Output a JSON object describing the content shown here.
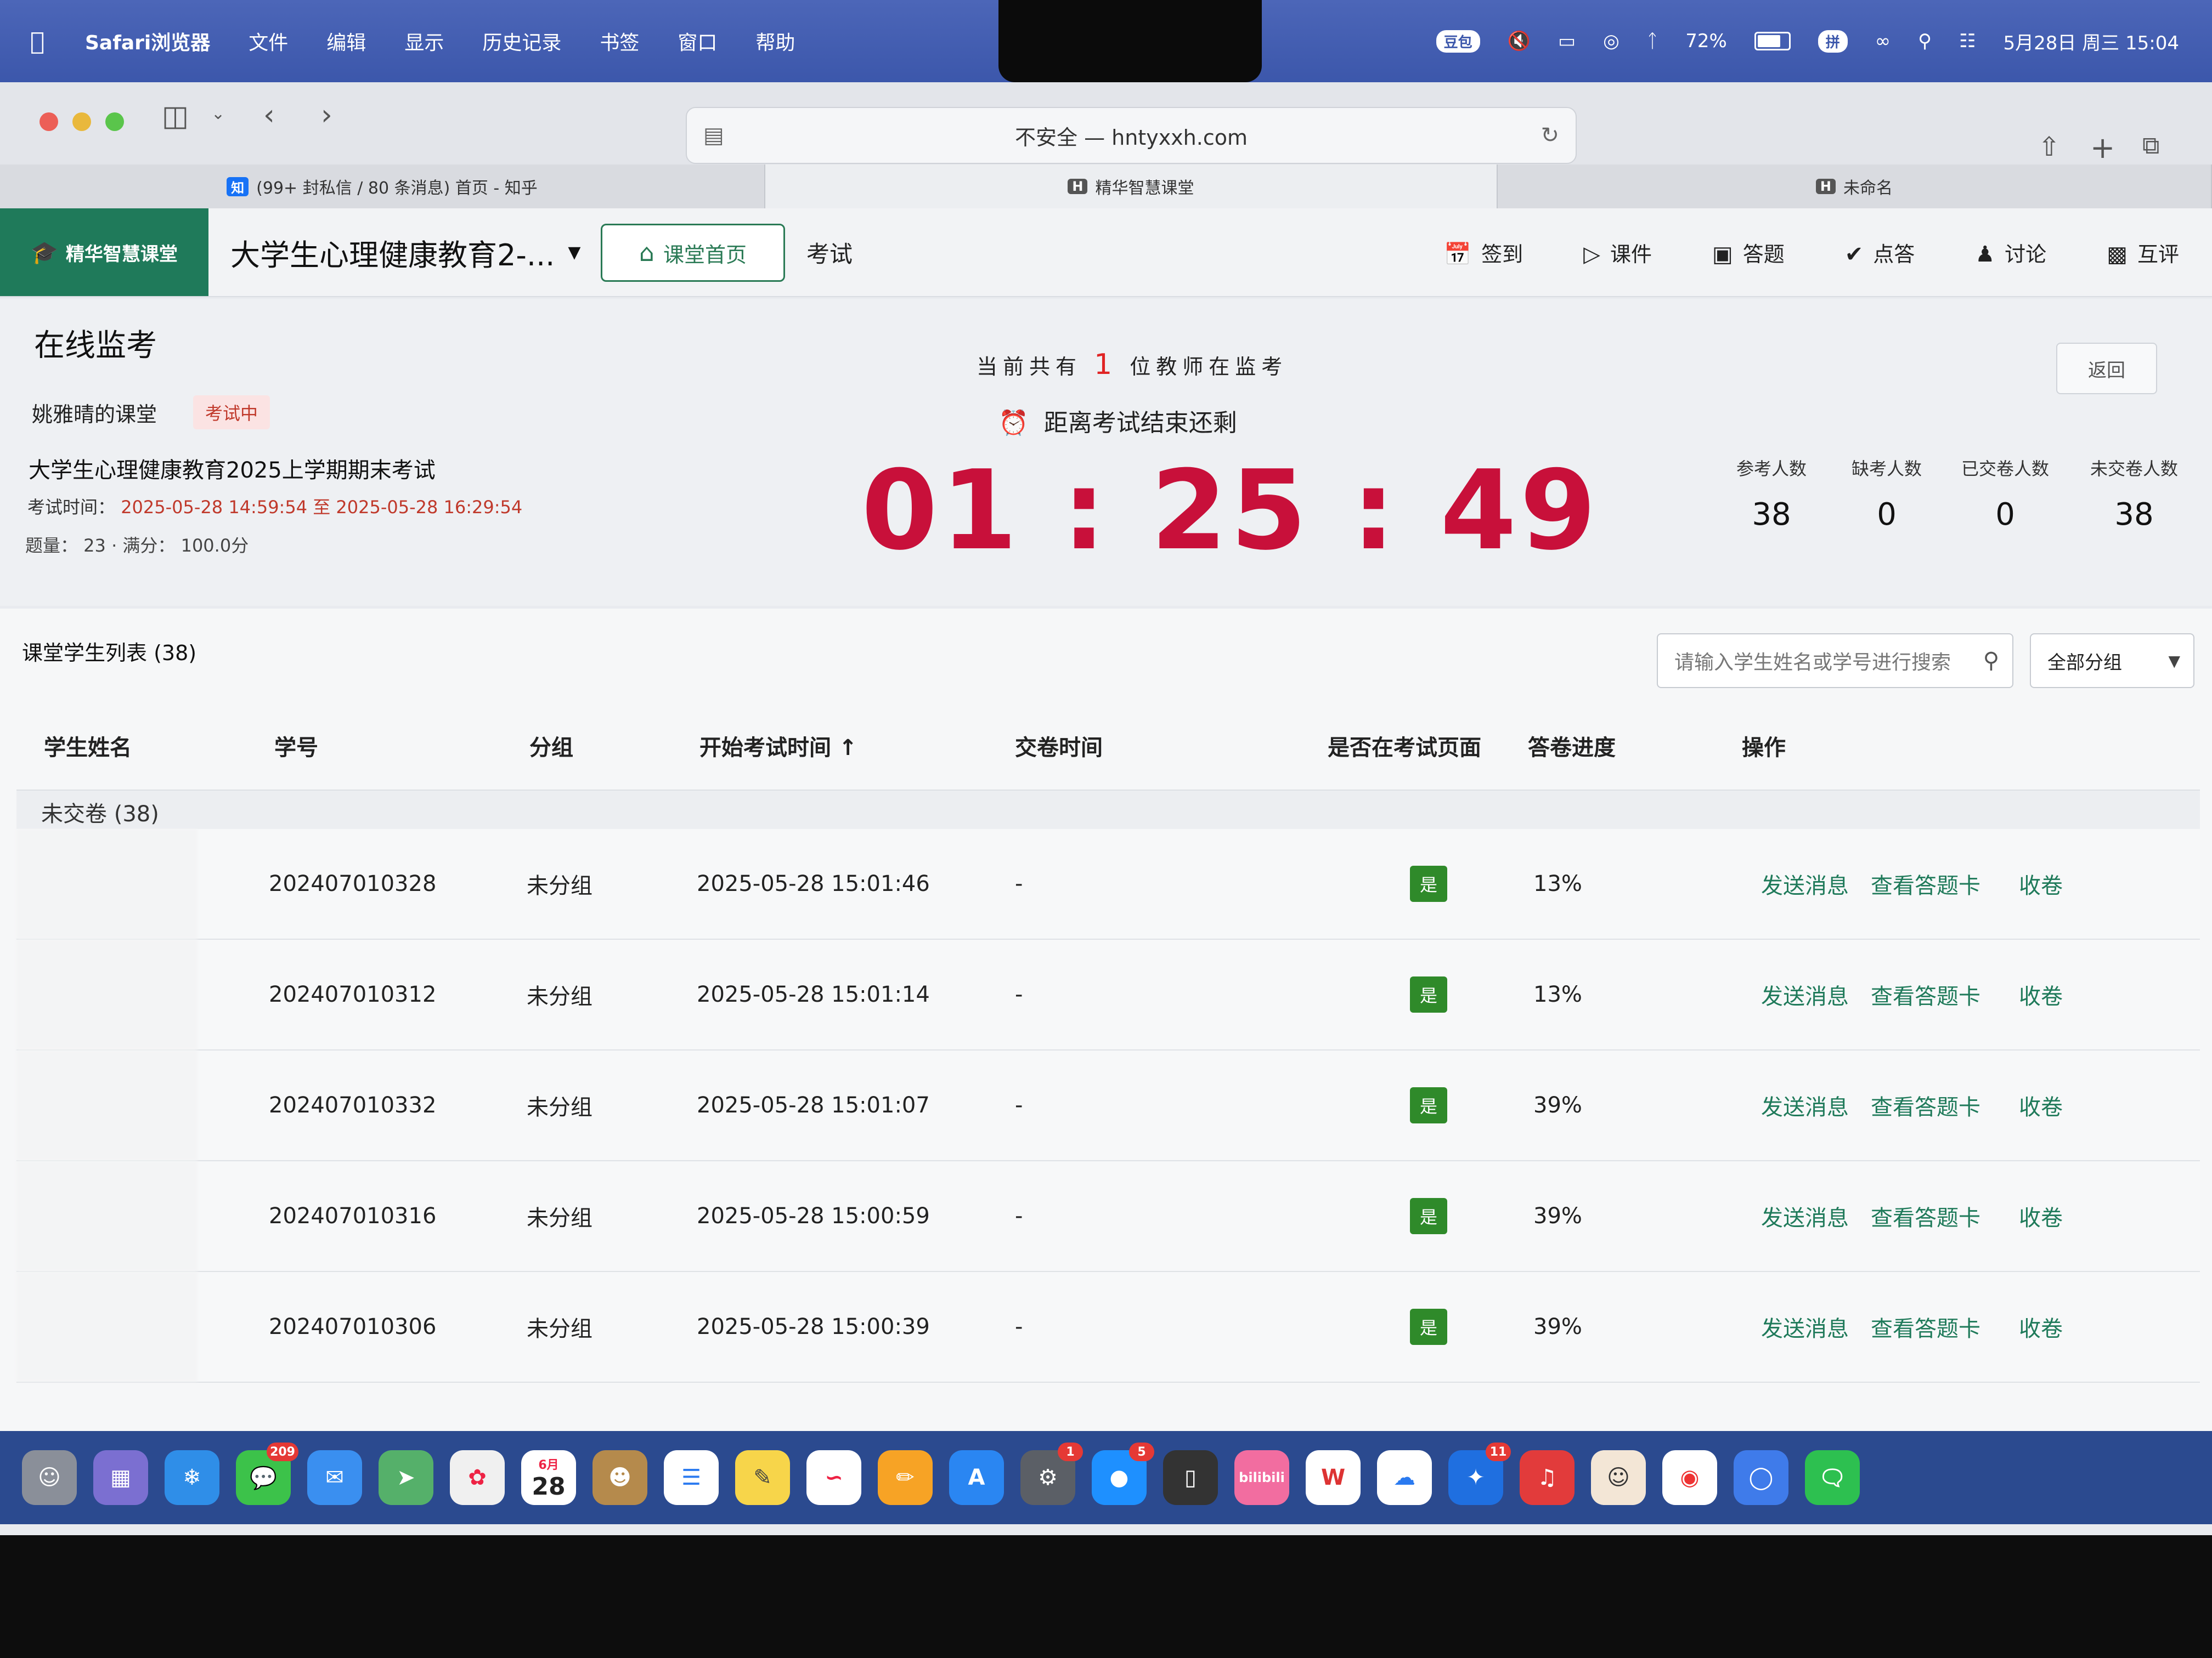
{
  "menubar": {
    "app_name": "Safari浏览器",
    "menus": [
      "文件",
      "编辑",
      "显示",
      "历史记录",
      "书签",
      "窗口",
      "帮助"
    ],
    "pill": "豆包",
    "battery": "72%",
    "input_method": "拼",
    "datetime": "5月28日 周三 15:04"
  },
  "browser": {
    "address": "不安全 — hntyxxh.com",
    "tabs": [
      {
        "icon": "知",
        "label": "(99+ 封私信 / 80 条消息) 首页 - 知乎"
      },
      {
        "icon": "H",
        "label": "精华智慧课堂"
      },
      {
        "icon": "H",
        "label": "未命名"
      }
    ]
  },
  "header": {
    "logo": "精华智慧课堂",
    "course": "大学生心理健康教育2-...",
    "home_button": "课堂首页",
    "exam_tab": "考试",
    "nav": [
      {
        "icon": "calendar-check-icon",
        "label": "签到"
      },
      {
        "icon": "play-screen-icon",
        "label": "课件"
      },
      {
        "icon": "answer-icon",
        "label": "答题"
      },
      {
        "icon": "check-circle-icon",
        "label": "点答"
      },
      {
        "icon": "discussion-icon",
        "label": "讨论"
      },
      {
        "icon": "chart-icon",
        "label": "互评"
      }
    ]
  },
  "monitor": {
    "title": "在线监考",
    "teacher_class": "姚雅晴的课堂",
    "status": "考试中",
    "exam_name": "大学生心理健康教育2025上学期期末考试",
    "time_label": "考试时间：",
    "time_start": "2025-05-28 14:59:54",
    "time_to": "至",
    "time_end": "2025-05-28 16:29:54",
    "meta": "题量： 23 · 满分： 100.0分",
    "monitor_prefix": "当前共有",
    "monitor_count": "1",
    "monitor_suffix": "位教师在监考",
    "remaining_label": "距离考试结束还剩",
    "countdown": "01 : 25 : 49",
    "back": "返回",
    "stats": [
      {
        "label": "参考人数",
        "value": "38"
      },
      {
        "label": "缺考人数",
        "value": "0"
      },
      {
        "label": "已交卷人数",
        "value": "0"
      },
      {
        "label": "未交卷人数",
        "value": "38"
      }
    ]
  },
  "list": {
    "title": "课堂学生列表 (38)",
    "search_placeholder": "请输入学生姓名或学号进行搜索",
    "group_select": "全部分组",
    "columns": [
      "学生姓名",
      "学号",
      "分组",
      "开始考试时间 ↑",
      "交卷时间",
      "是否在考试页面",
      "答卷进度",
      "操作"
    ],
    "group_label": "未交卷 (38)",
    "rows": [
      {
        "id": "202407010328",
        "group": "未分组",
        "start": "2025-05-28 15:01:46",
        "submit": "-",
        "on_page": "是",
        "progress": "13%"
      },
      {
        "id": "202407010312",
        "group": "未分组",
        "start": "2025-05-28 15:01:14",
        "submit": "-",
        "on_page": "是",
        "progress": "13%"
      },
      {
        "id": "202407010332",
        "group": "未分组",
        "start": "2025-05-28 15:01:07",
        "submit": "-",
        "on_page": "是",
        "progress": "39%"
      },
      {
        "id": "202407010316",
        "group": "未分组",
        "start": "2025-05-28 15:00:59",
        "submit": "-",
        "on_page": "是",
        "progress": "39%"
      },
      {
        "id": "202407010306",
        "group": "未分组",
        "start": "2025-05-28 15:00:39",
        "submit": "-",
        "on_page": "是",
        "progress": "39%"
      }
    ],
    "actions": [
      "发送消息",
      "查看答题卡",
      "收卷"
    ]
  },
  "dock": {
    "messages_badge": "209",
    "calendar_month": "6月",
    "calendar_day": "28",
    "settings_badge": "1",
    "qq_badge": "5",
    "app_badge": "11",
    "bilibili": "bilibili"
  }
}
